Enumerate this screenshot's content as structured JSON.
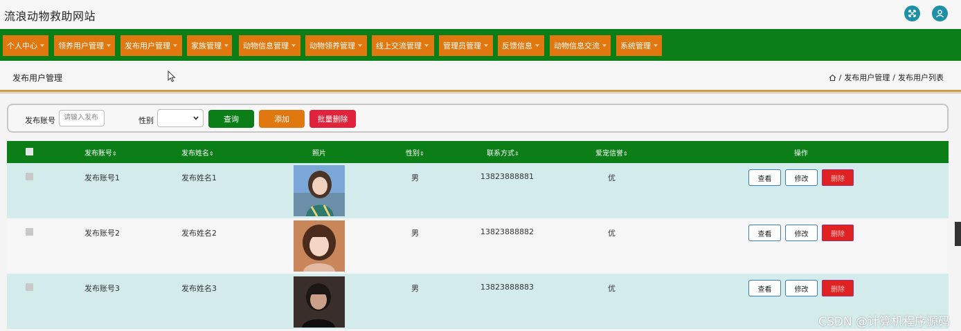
{
  "site": {
    "title": "流浪动物救助网站"
  },
  "nav": {
    "items": [
      {
        "label": "个人中心"
      },
      {
        "label": "领养用户管理"
      },
      {
        "label": "发布用户管理"
      },
      {
        "label": "家族管理"
      },
      {
        "label": "动物信息管理"
      },
      {
        "label": "动物领养管理"
      },
      {
        "label": "线上交流管理"
      },
      {
        "label": "管理员管理"
      },
      {
        "label": "反馈信息"
      },
      {
        "label": "动物信息交流"
      },
      {
        "label": "系统管理"
      }
    ]
  },
  "page": {
    "heading": "发布用户管理",
    "breadcrumb": {
      "sep": "/",
      "first": "发布用户管理",
      "second": "发布用户列表"
    }
  },
  "search": {
    "account_label": "发布账号",
    "account_placeholder": "请输入发布",
    "gender_label": "性别",
    "gender_value": "",
    "query_label": "查询",
    "add_label": "添加",
    "batch_delete_label": "批量删除"
  },
  "colors": {
    "nav_bg": "#0c7e18",
    "nav_item": "#e0780f",
    "query_btn": "#0c7e18",
    "add_btn": "#e0780f",
    "delete_btn": "#e02222",
    "row_even": "#d4ebeb"
  },
  "table": {
    "headers": {
      "account": "发布账号",
      "name": "发布姓名",
      "photo": "照片",
      "gender": "性别",
      "phone": "联系方式",
      "credit": "爱宠信誉",
      "ops": "操作",
      "sort": "⇕"
    },
    "rows": [
      {
        "account": "发布账号1",
        "name": "发布姓名1",
        "gender": "男",
        "phone": "13823888881",
        "credit": "优",
        "view": "查看",
        "edit": "修改",
        "delete": "删除"
      },
      {
        "account": "发布账号2",
        "name": "发布姓名2",
        "gender": "男",
        "phone": "13823888882",
        "credit": "优",
        "view": "查看",
        "edit": "修改",
        "delete": "删除"
      },
      {
        "account": "发布账号3",
        "name": "发布姓名3",
        "gender": "男",
        "phone": "13823888883",
        "credit": "优",
        "view": "查看",
        "edit": "修改",
        "delete": "删除"
      }
    ]
  },
  "watermark": "CSDN @计算机程序源码"
}
